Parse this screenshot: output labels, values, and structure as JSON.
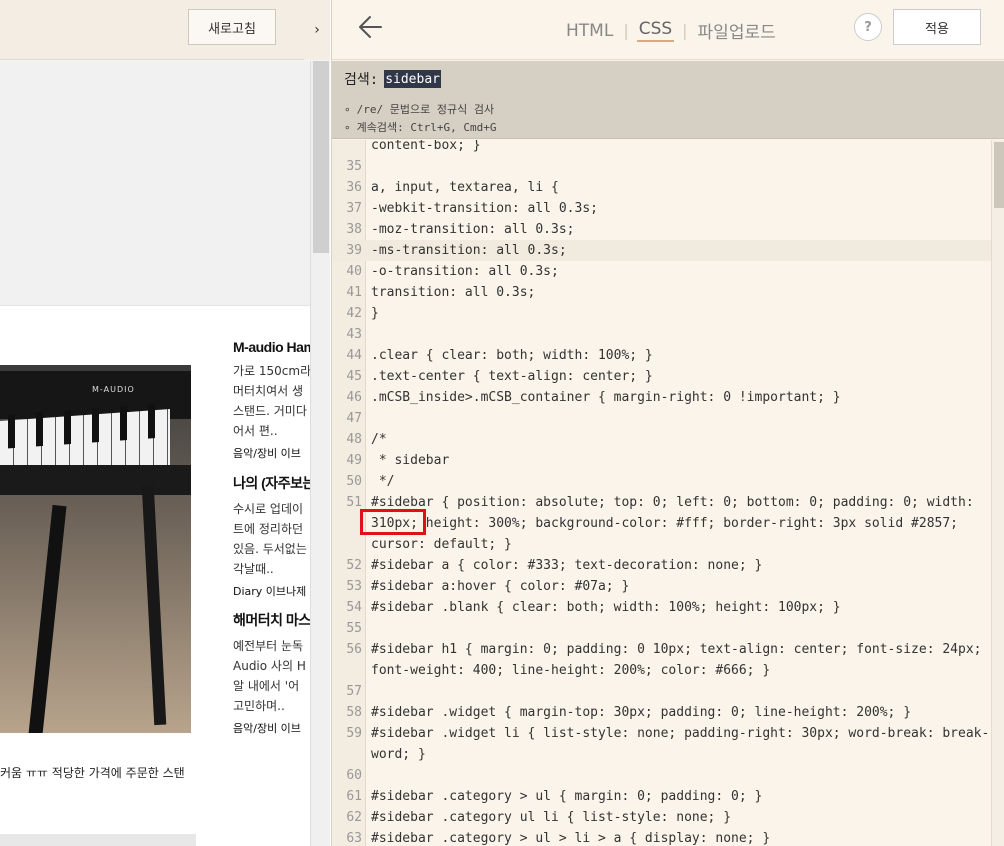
{
  "preview": {
    "refresh_label": "새로고침",
    "collapse_arrow": "›",
    "piano_brand": "M-AUDIO",
    "posts": [
      {
        "title": "M-audio Hammer",
        "lines": [
          "가로 150cm라",
          "머터치여서 생",
          "스탠드. 거미다",
          "어서 편.."
        ],
        "meta": "음악/장비  이브"
      },
      {
        "title": "나의 (자주보는",
        "lines": [
          "수시로 업데이",
          "트에 정리하던",
          "있음. 두서없는",
          "각날때.."
        ],
        "meta": "Diary  이브나제"
      },
      {
        "title": "해머터치 마스터",
        "lines": [
          "예전부터 눈독",
          "Audio 사의 H",
          "알 내에서 '어",
          "고민하며.."
        ],
        "meta": "음악/장비  이브"
      }
    ],
    "caption": "커움 ㅠㅠ 적당한 가격에 주문한 스탠"
  },
  "editor": {
    "tabs": [
      {
        "label": "HTML",
        "active": false
      },
      {
        "label": "CSS",
        "active": true
      },
      {
        "label": "파일업로드",
        "active": false
      }
    ],
    "help_label": "?",
    "apply_label": "적용",
    "search": {
      "label": "검색:",
      "value": "sidebar",
      "hints": [
        "/re/ 문법으로 정규식 검사",
        "계속검색: Ctrl+G, Cmd+G"
      ]
    },
    "code_lines": [
      {
        "n": "",
        "t": "content-box; }"
      },
      {
        "n": "35",
        "t": ""
      },
      {
        "n": "36",
        "t": "a, input, textarea, li {"
      },
      {
        "n": "37",
        "t": "-webkit-transition: all 0.3s;"
      },
      {
        "n": "38",
        "t": "-moz-transition: all 0.3s;"
      },
      {
        "n": "39",
        "t": "-ms-transition: all 0.3s;",
        "hl": true
      },
      {
        "n": "40",
        "t": "-o-transition: all 0.3s;"
      },
      {
        "n": "41",
        "t": "transition: all 0.3s;"
      },
      {
        "n": "42",
        "t": "}"
      },
      {
        "n": "43",
        "t": ""
      },
      {
        "n": "44",
        "t": ".clear { clear: both; width: 100%; }"
      },
      {
        "n": "45",
        "t": ".text-center { text-align: center; }"
      },
      {
        "n": "46",
        "t": ".mCSB_inside>.mCSB_container { margin-right: 0 !important; }"
      },
      {
        "n": "47",
        "t": ""
      },
      {
        "n": "48",
        "t": "/*"
      },
      {
        "n": "49",
        "t": " * sidebar"
      },
      {
        "n": "50",
        "t": " */"
      },
      {
        "n": "51",
        "t": "#sidebar { position: absolute; top: 0; left: 0; bottom: 0; padding: 0; width:"
      },
      {
        "n": "",
        "t": "310px; height: 300%; background-color: #fff; border-right: 3px solid #2857;"
      },
      {
        "n": "",
        "t": "cursor: default; }"
      },
      {
        "n": "52",
        "t": "#sidebar a { color: #333; text-decoration: none; }"
      },
      {
        "n": "53",
        "t": "#sidebar a:hover { color: #07a; }"
      },
      {
        "n": "54",
        "t": "#sidebar .blank { clear: both; width: 100%; height: 100px; }"
      },
      {
        "n": "55",
        "t": ""
      },
      {
        "n": "56",
        "t": "#sidebar h1 { margin: 0; padding: 0 10px; text-align: center; font-size: 24px;"
      },
      {
        "n": "",
        "t": "font-weight: 400; line-height: 200%; color: #666; }"
      },
      {
        "n": "57",
        "t": ""
      },
      {
        "n": "58",
        "t": "#sidebar .widget { margin-top: 30px; padding: 0; line-height: 200%; }"
      },
      {
        "n": "59",
        "t": "#sidebar .widget li { list-style: none; padding-right: 30px; word-break: break-"
      },
      {
        "n": "",
        "t": "word; }"
      },
      {
        "n": "60",
        "t": ""
      },
      {
        "n": "61",
        "t": "#sidebar .category > ul { margin: 0; padding: 0; }"
      },
      {
        "n": "62",
        "t": "#sidebar .category ul li { list-style: none; }"
      },
      {
        "n": "63",
        "t": "#sidebar .category > ul > li > a { display: none; }"
      }
    ]
  },
  "colors": {
    "accent_underline": "#d9a980",
    "highlight_box": "#e0101a",
    "search_match_bg": "#2f3748"
  }
}
